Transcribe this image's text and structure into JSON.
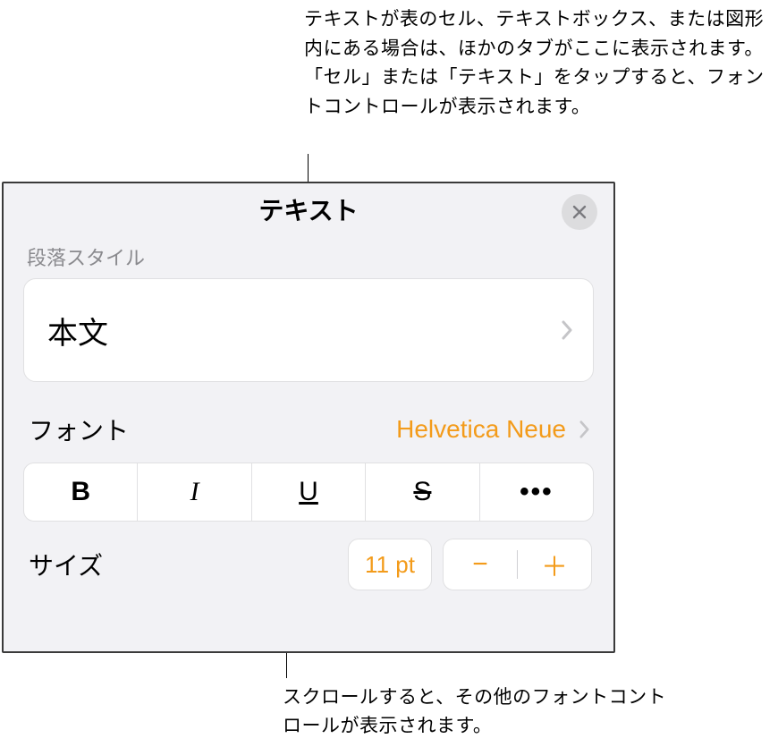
{
  "callouts": {
    "top": "テキストが表のセル、テキストボックス、または図形内にある場合は、ほかのタブがここに表示されます。「セル」または「テキスト」をタップすると、フォントコントロールが表示されます。",
    "bottom": "スクロールすると、その他のフォントコントロールが表示されます。"
  },
  "panel": {
    "title": "テキスト",
    "close_label": "閉じる",
    "paragraph_style": {
      "label": "段落スタイル",
      "value": "本文"
    },
    "font": {
      "label": "フォント",
      "value": "Helvetica Neue"
    },
    "style_buttons": {
      "bold": "B",
      "italic": "I",
      "underline": "U",
      "strike": "S",
      "more": "…"
    },
    "size": {
      "label": "サイズ",
      "value": "11 pt",
      "minus": "−",
      "plus": "＋"
    }
  },
  "colors": {
    "accent": "#f39b1a",
    "panel_bg": "#f2f2f5",
    "muted": "#8a8a8e"
  }
}
